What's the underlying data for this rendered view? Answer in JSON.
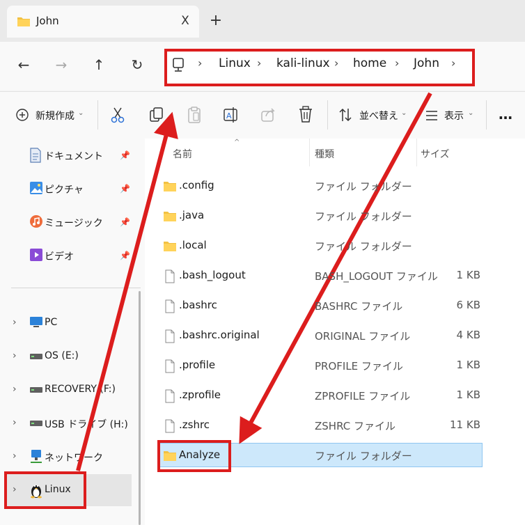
{
  "tab": {
    "title": "John",
    "close": "X",
    "new": "+"
  },
  "nav": {
    "back": "←",
    "forward": "→",
    "up": "↑",
    "refresh": "↻"
  },
  "breadcrumb": [
    "Linux",
    "kali-linux",
    "home",
    "John"
  ],
  "breadcrumb_sep": "›",
  "toolbar": {
    "new_label": "新規作成",
    "sort_label": "並べ替え",
    "view_label": "表示",
    "more_label": "…"
  },
  "sidebar": {
    "quick": [
      {
        "label": "ドキュメント",
        "icon": "document-icon"
      },
      {
        "label": "ピクチャ",
        "icon": "pictures-icon"
      },
      {
        "label": "ミュージック",
        "icon": "music-icon"
      },
      {
        "label": "ビデオ",
        "icon": "video-icon"
      }
    ],
    "tree": [
      {
        "label": "PC",
        "icon": "pc-icon"
      },
      {
        "label": "OS (E:)",
        "icon": "drive-icon"
      },
      {
        "label": "RECOVERY (F:)",
        "icon": "drive-icon"
      },
      {
        "label": "USB ドライブ (H:)",
        "icon": "drive-icon"
      },
      {
        "label": "ネットワーク",
        "icon": "network-icon"
      },
      {
        "label": "Linux",
        "icon": "linux-icon"
      }
    ]
  },
  "columns": {
    "name": "名前",
    "type": "種類",
    "size": "サイズ"
  },
  "files": [
    {
      "name": ".config",
      "type": "ファイル フォルダー",
      "size": "",
      "kind": "folder"
    },
    {
      "name": ".java",
      "type": "ファイル フォルダー",
      "size": "",
      "kind": "folder"
    },
    {
      "name": ".local",
      "type": "ファイル フォルダー",
      "size": "",
      "kind": "folder"
    },
    {
      "name": ".bash_logout",
      "type": "BASH_LOGOUT ファイル",
      "size": "1 KB",
      "kind": "file"
    },
    {
      "name": ".bashrc",
      "type": "BASHRC ファイル",
      "size": "6 KB",
      "kind": "file"
    },
    {
      "name": ".bashrc.original",
      "type": "ORIGINAL ファイル",
      "size": "4 KB",
      "kind": "file"
    },
    {
      "name": ".profile",
      "type": "PROFILE ファイル",
      "size": "1 KB",
      "kind": "file"
    },
    {
      "name": ".zprofile",
      "type": "ZPROFILE ファイル",
      "size": "1 KB",
      "kind": "file"
    },
    {
      "name": ".zshrc",
      "type": "ZSHRC ファイル",
      "size": "11 KB",
      "kind": "file"
    },
    {
      "name": "Analyze",
      "type": "ファイル フォルダー",
      "size": "",
      "kind": "folder",
      "selected": true
    }
  ],
  "colors": {
    "annotation": "#dc1d1d",
    "selection": "#cde8fb",
    "folder": "#f2c143"
  }
}
